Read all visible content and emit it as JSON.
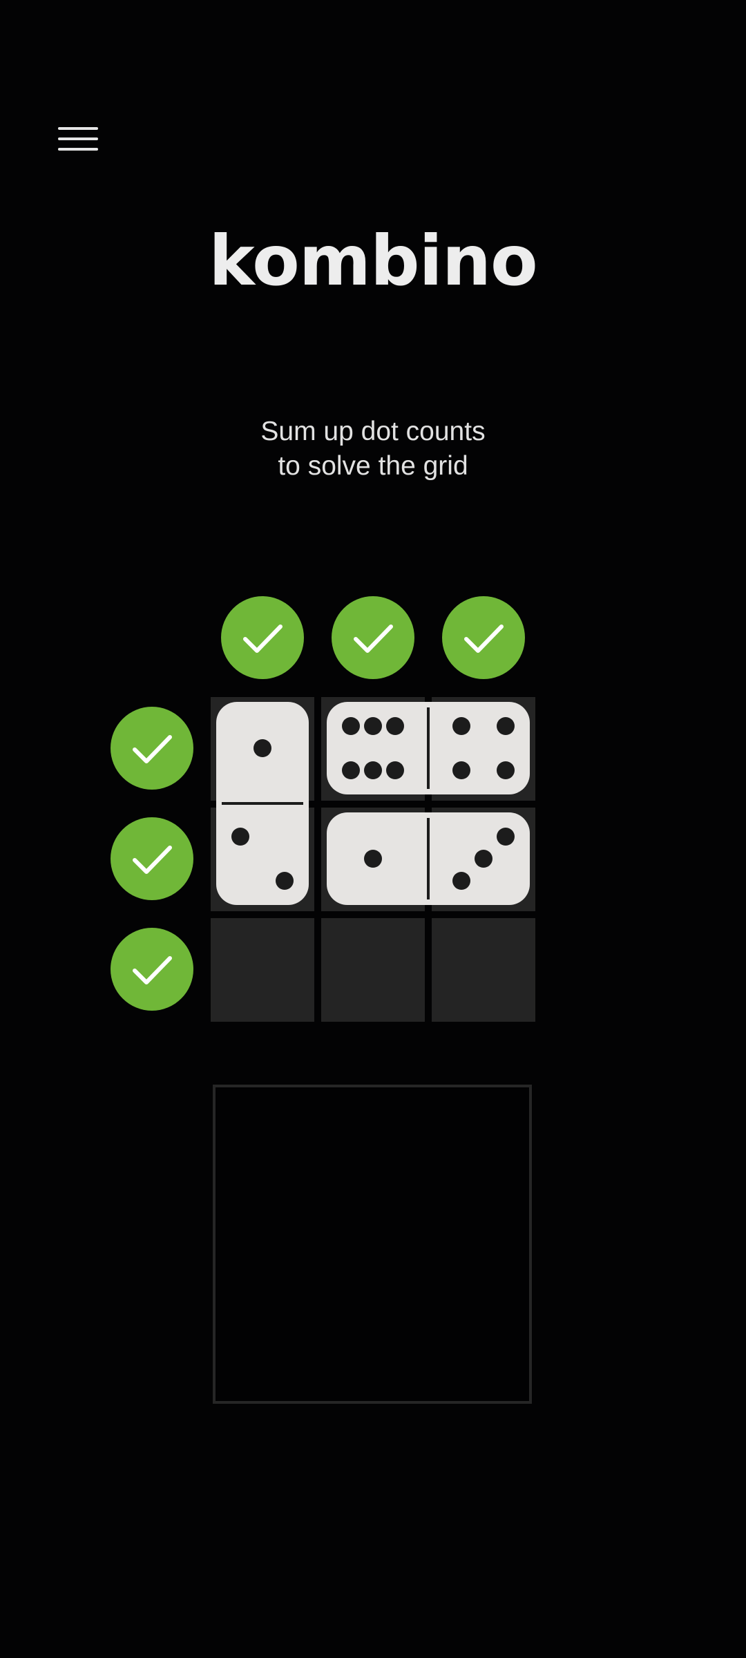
{
  "header": {
    "menu_icon": "hamburger-menu-icon",
    "title": "kombino"
  },
  "instructions": {
    "line1": "Sum up dot counts",
    "line2": "to solve the grid"
  },
  "colors": {
    "background": "#030304",
    "check_green": "#70b738",
    "cell_empty": "#242424",
    "domino_face": "#e6e4e2",
    "pip": "#1c1c1c"
  },
  "board": {
    "column_checks": [
      {
        "status": "solved",
        "icon": "checkmark-icon"
      },
      {
        "status": "solved",
        "icon": "checkmark-icon"
      },
      {
        "status": "solved",
        "icon": "checkmark-icon"
      }
    ],
    "row_checks": [
      {
        "status": "solved",
        "icon": "checkmark-icon"
      },
      {
        "status": "solved",
        "icon": "checkmark-icon"
      },
      {
        "status": "solved",
        "icon": "checkmark-icon"
      }
    ],
    "dominoes": [
      {
        "name": "vertical",
        "orientation": "vertical",
        "pips": [
          1,
          2
        ]
      },
      {
        "name": "top-horizontal",
        "orientation": "horizontal",
        "pips": [
          6,
          4
        ]
      },
      {
        "name": "middle-horizontal",
        "orientation": "horizontal",
        "pips": [
          1,
          3
        ]
      }
    ],
    "empty_row_cells": 3
  },
  "tray": {
    "content": "empty"
  }
}
